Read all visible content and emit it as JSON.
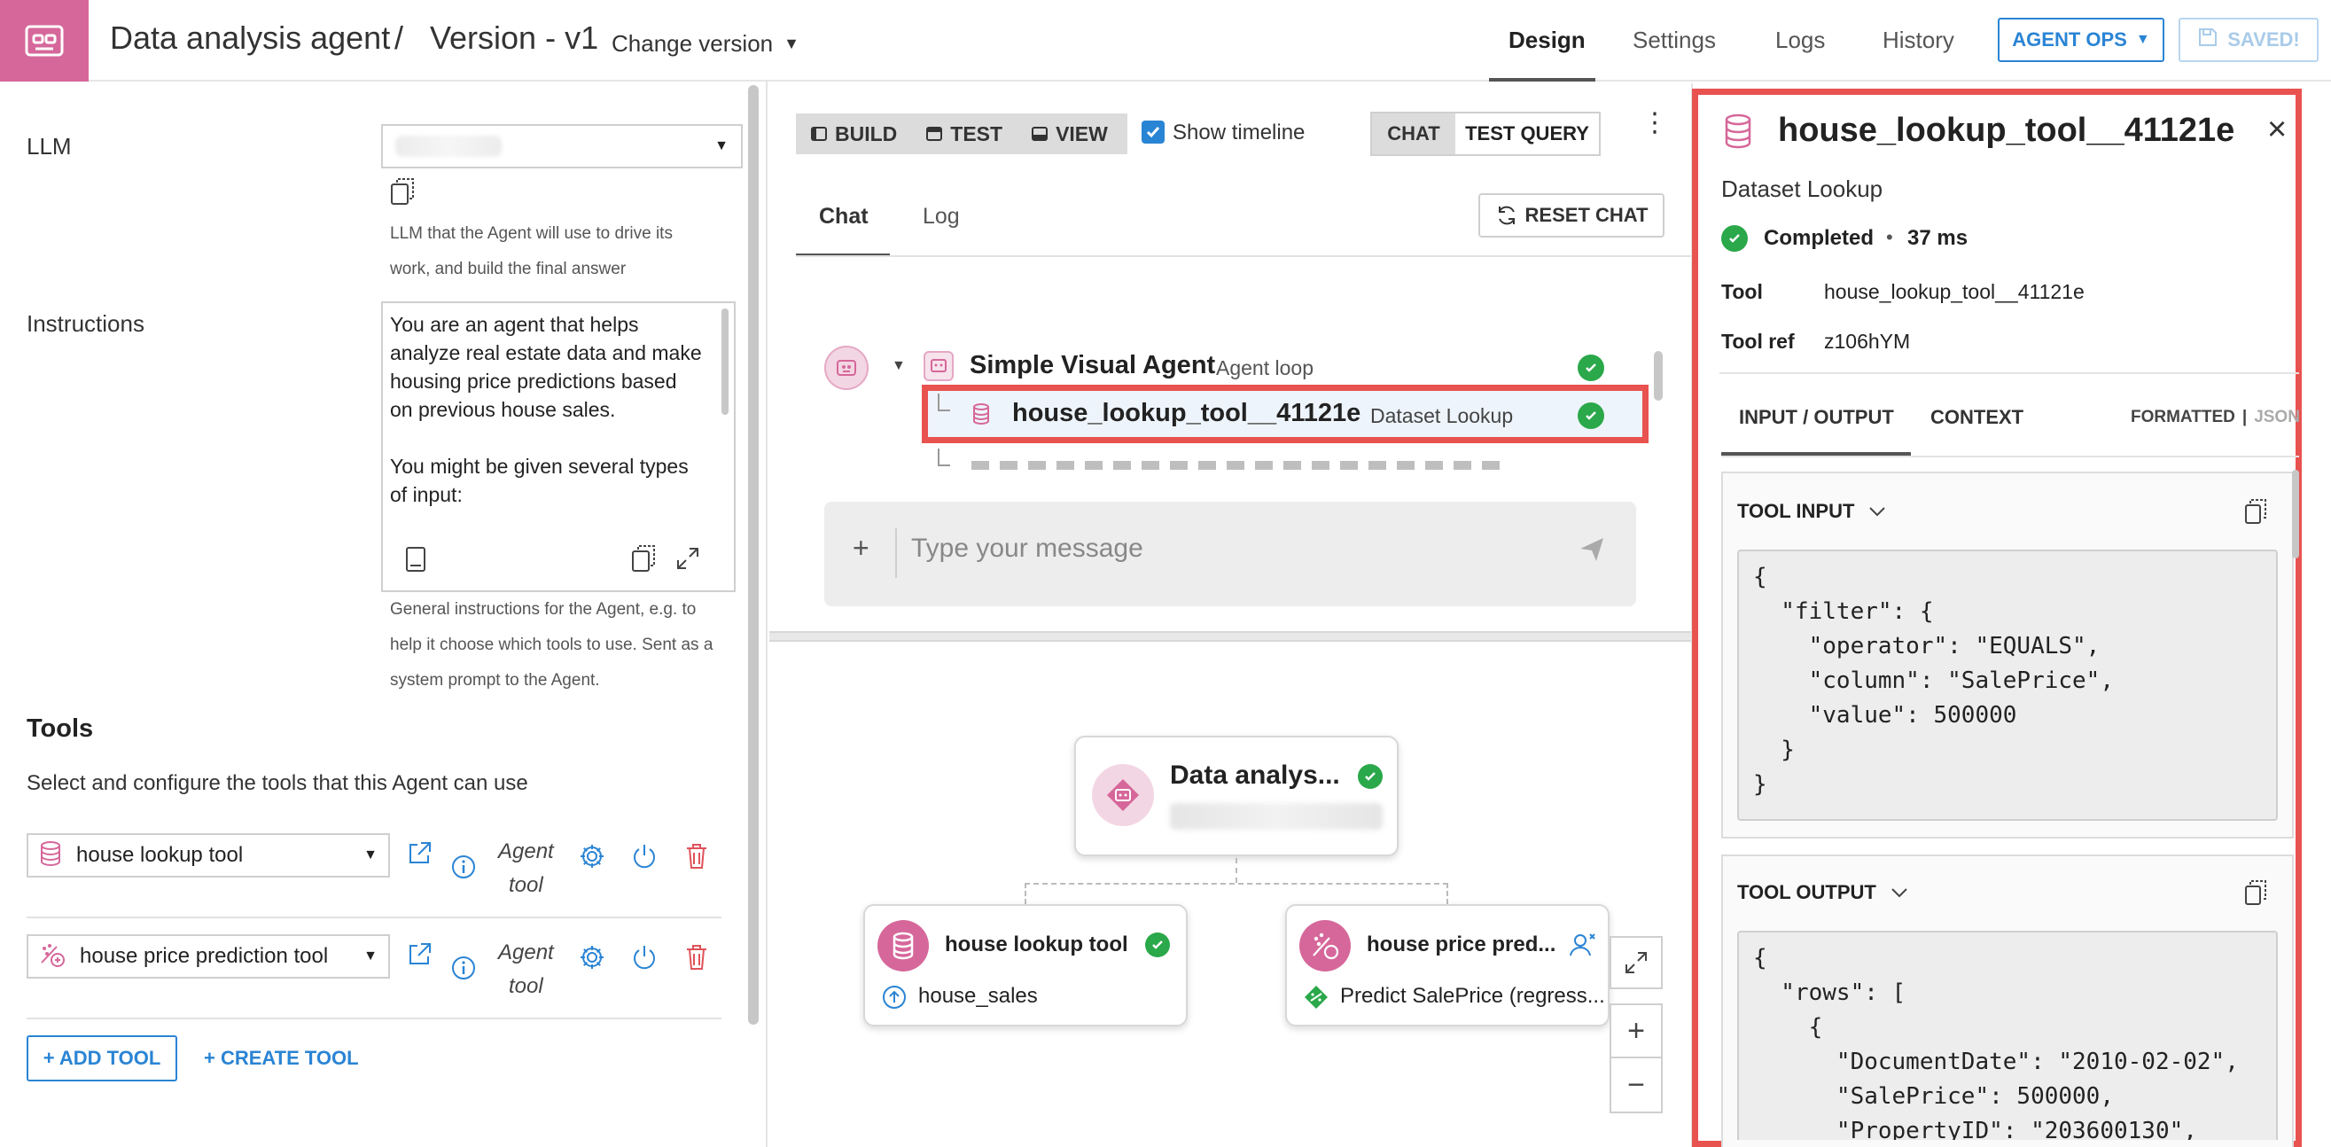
{
  "header": {
    "agent_name": "Data analysis agent",
    "separator": "/",
    "version": "Version - v1",
    "change_version": "Change version",
    "nav": [
      "Design",
      "Settings",
      "Logs",
      "History"
    ],
    "agent_ops": "AGENT OPS",
    "saved": "SAVED!"
  },
  "left": {
    "llm_label": "LLM",
    "llm_help": [
      "LLM that the Agent will use to drive its",
      "work, and build the final answer"
    ],
    "instructions_label": "Instructions",
    "instructions_text": [
      "You are an agent that helps",
      "analyze real estate data and make",
      "housing price predictions based",
      "on previous house sales.",
      "",
      "You might be given several types",
      "of input:"
    ],
    "instructions_help": [
      "General instructions for the Agent, e.g. to",
      "help it choose which tools to use. Sent as a",
      "system prompt to the Agent."
    ],
    "tools_title": "Tools",
    "tools_desc": "Select and configure the tools that this Agent can use",
    "tools": [
      {
        "name": "house lookup tool",
        "kind_1": "Agent",
        "kind_2": "tool"
      },
      {
        "name": "house price prediction tool",
        "kind_1": "Agent",
        "kind_2": "tool"
      }
    ],
    "add_tool": "+ ADD TOOL",
    "create_tool": "+ CREATE TOOL"
  },
  "middle": {
    "toolbar": {
      "build": "BUILD",
      "test": "TEST",
      "view": "VIEW",
      "show_timeline": "Show timeline",
      "chat": "CHAT",
      "test_query": "TEST QUERY"
    },
    "tabs": [
      "Chat",
      "Log"
    ],
    "reset_chat": "RESET CHAT",
    "trace": {
      "root_name": "Simple Visual Agent",
      "root_type": "Agent loop",
      "child_name": "house_lookup_tool__41121e",
      "child_type": "Dataset Lookup"
    },
    "message_placeholder": "Type your message",
    "flow": {
      "root_title": "Data analys...",
      "left_title": "house lookup tool",
      "left_sub": "house_sales",
      "right_title": "house price pred...",
      "right_sub": "Predict SalePrice (regress..."
    }
  },
  "right": {
    "title": "house_lookup_tool__41121e",
    "subtitle": "Dataset Lookup",
    "status": "Completed",
    "dot": "•",
    "duration": "37 ms",
    "tool_label": "Tool",
    "tool_value": "house_lookup_tool__41121e",
    "toolref_label": "Tool ref",
    "toolref_value": "z106hYM",
    "tabs": [
      "INPUT / OUTPUT",
      "CONTEXT"
    ],
    "formatted": "FORMATTED",
    "pipe": "|",
    "json": "JSON",
    "tool_input_title": "TOOL INPUT",
    "tool_input": "{\n  \"filter\": {\n    \"operator\": \"EQUALS\",\n    \"column\": \"SalePrice\",\n    \"value\": 500000\n  }\n}",
    "tool_output_title": "TOOL OUTPUT",
    "tool_output": "{\n  \"rows\": [\n    {\n      \"DocumentDate\": \"2010-02-02\",\n      \"SalePrice\": 500000,\n      \"PropertyID\": \"203600130\","
  },
  "colors": {
    "brand_pink": "#d6679a",
    "accent_blue": "#2a84d4",
    "success_green": "#2aa84a",
    "highlight_red": "#e8524f"
  }
}
